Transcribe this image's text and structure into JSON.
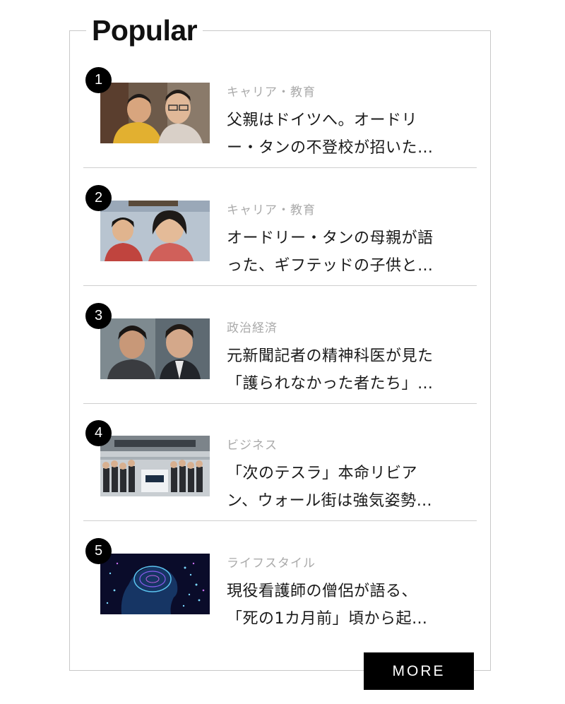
{
  "widget": {
    "title": "Popular",
    "more_label": "MORE"
  },
  "items": [
    {
      "rank": "1",
      "category": "キャリア・教育",
      "headline_line1": "父親はドイツへ。オードリ",
      "headline_line2": "ー・タンの不登校が招いた…",
      "thumbnail": "family-photo"
    },
    {
      "rank": "2",
      "category": "キャリア・教育",
      "headline_line1": "オードリー・タンの母親が語",
      "headline_line2": "った、ギフテッドの子供と…",
      "thumbnail": "children-photo"
    },
    {
      "rank": "3",
      "category": "政治経済",
      "headline_line1": "元新聞記者の精神科医が見た",
      "headline_line2": "「護られなかった者たち」…",
      "thumbnail": "movie-still"
    },
    {
      "rank": "4",
      "category": "ビジネス",
      "headline_line1": "「次のテスラ」本命リビア",
      "headline_line2": "ン、ウォール街は強気姿勢…",
      "thumbnail": "stock-exchange-crowd"
    },
    {
      "rank": "5",
      "category": "ライフスタイル",
      "headline_line1": "現役看護師の僧侶が語る、",
      "headline_line2": "「死の1カ月前」頃から起…",
      "thumbnail": "digital-head-illustration"
    }
  ]
}
